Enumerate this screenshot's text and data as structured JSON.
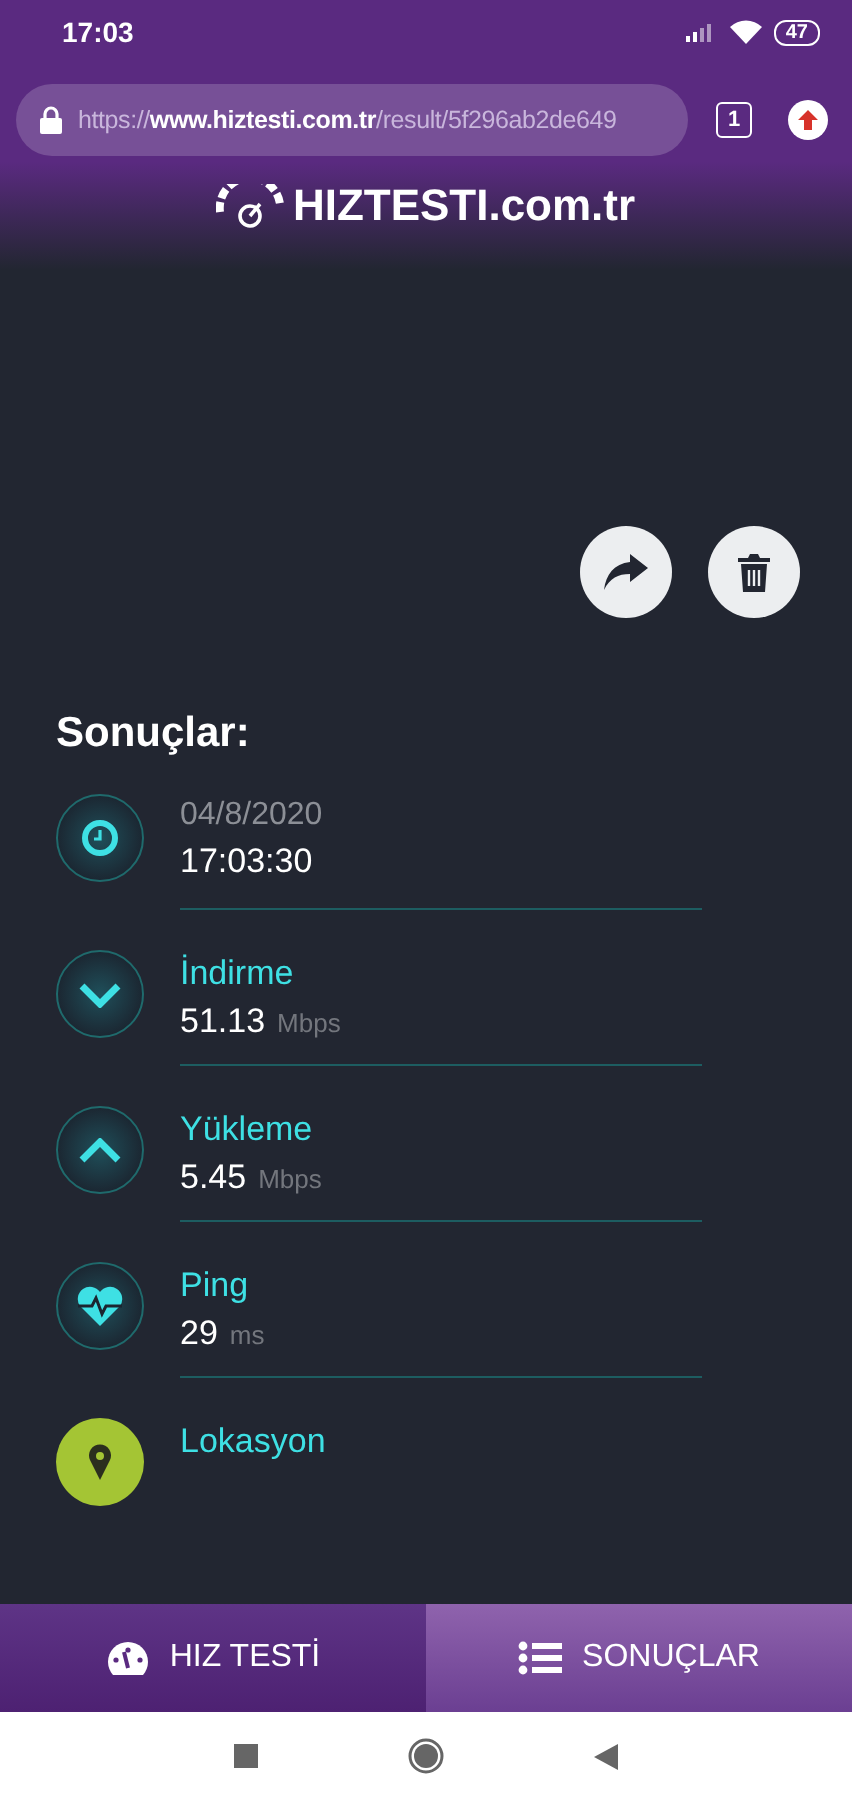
{
  "status_bar": {
    "time": "17:03",
    "battery": "47"
  },
  "browser": {
    "url": "https://**www.hiztesti.com.tr**/result/5f296ab2de649",
    "tab_count": "1"
  },
  "site": {
    "logo": "HIZTESTI.com.tr"
  },
  "section_title": "Sonuçlar:",
  "results": [
    {
      "kind": "time",
      "date": "04/8/2020",
      "time": "17:03:30"
    },
    {
      "kind": "download",
      "label": "İndirme",
      "value": "51.13",
      "unit": "Mbps"
    },
    {
      "kind": "upload",
      "label": "Yükleme",
      "value": "5.45",
      "unit": "Mbps"
    },
    {
      "kind": "ping",
      "label": "Ping",
      "value": "29",
      "unit": "ms"
    },
    {
      "kind": "location",
      "label": "Lokasyon"
    }
  ],
  "tabs": [
    {
      "kind": "gauge",
      "label": "HIZ TESTİ",
      "selected": false
    },
    {
      "kind": "list",
      "label": "SONUÇLAR",
      "selected": true
    }
  ]
}
